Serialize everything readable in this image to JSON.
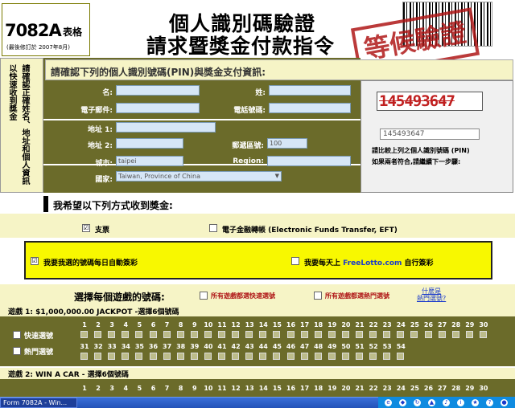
{
  "header": {
    "form_code": "7082A",
    "form_code_suffix": "表格",
    "revised": "(最後修訂於 2007年8月)",
    "title_line1": "個人識別碼驗證",
    "title_line2": "請求暨獎金付款指令",
    "stamp_text": "等候驗證"
  },
  "sidebar": {
    "text": "請確認正確姓名、地址和個人資訊以快速收到獎金"
  },
  "pin_section": {
    "heading": "請確認下列的個人識別號碼(PIN)與獎金支付資訊:",
    "labels": {
      "name": "名:",
      "surname": "姓:",
      "email": "電子郵件:",
      "phone": "電話號碼:",
      "address1": "地址 1:",
      "address2": "地址 2:",
      "postal": "郵遞區號:",
      "city": "城市:",
      "region": "Region:",
      "country": "國家:"
    },
    "values": {
      "name": "",
      "surname": "",
      "email": "",
      "phone": "",
      "address1": "",
      "address2": "",
      "postal": "100",
      "city": "taipei",
      "region": "",
      "country": "Taiwan, Province of China"
    },
    "captcha": "145493647",
    "pin_input": "145493647",
    "note1": "請比較上列之個人識別號碼 (PIN)",
    "note2": "如果兩者符合,請繼續下一步驟:"
  },
  "prize": {
    "heading": "我希望以下列方式收到獎金:",
    "option_check_checkbox": "☑",
    "option_check": "支票",
    "option_eft_checkbox": "",
    "option_eft": "電子金融轉帳 (Electronic Funds Transfer, EFT)",
    "auto_checkbox": "☑",
    "auto_label": "我要我選的號碼每日自動簽彩",
    "daily_checkbox": "",
    "daily_label_pre": "我要每天上",
    "daily_label_site": "FreeLotto.com",
    "daily_label_post": "自行簽彩"
  },
  "choose": {
    "heading": "選擇每個遊戲的號碼:",
    "opt_all_quick": "所有遊戲都選快速選號",
    "opt_all_hot": "所有遊戲都選熱門選號",
    "link_line1": "什麼是",
    "link_line2": "熱門選號?"
  },
  "game1": {
    "title": "遊戲 1: $1,000,000.00 JACKPOT -選擇6個號碼",
    "quick_pick": "快速選號",
    "hot_pick": "熱門選號",
    "row1": [
      "1",
      "2",
      "3",
      "4",
      "5",
      "6",
      "7",
      "8",
      "9",
      "10",
      "11",
      "12",
      "13",
      "14",
      "15",
      "16",
      "17",
      "18",
      "19",
      "20",
      "21",
      "22",
      "23",
      "24",
      "25",
      "26",
      "27",
      "28",
      "29",
      "30"
    ],
    "row2": [
      "31",
      "32",
      "33",
      "34",
      "35",
      "36",
      "37",
      "38",
      "39",
      "40",
      "41",
      "42",
      "43",
      "44",
      "45",
      "46",
      "47",
      "48",
      "49",
      "50",
      "51",
      "52",
      "53",
      "54"
    ]
  },
  "game2": {
    "title": "遊戲 2: WIN A CAR - 選擇6個號碼",
    "quick_pick": "快速選號",
    "row1": [
      "1",
      "2",
      "3",
      "4",
      "5",
      "6",
      "7",
      "8",
      "9",
      "10",
      "11",
      "12",
      "13",
      "14",
      "15",
      "16",
      "17",
      "18",
      "19",
      "20",
      "21",
      "22",
      "23",
      "24",
      "25",
      "26",
      "27",
      "28",
      "29",
      "30"
    ]
  },
  "taskbar": {
    "item": "Form 7082A - Win..."
  }
}
